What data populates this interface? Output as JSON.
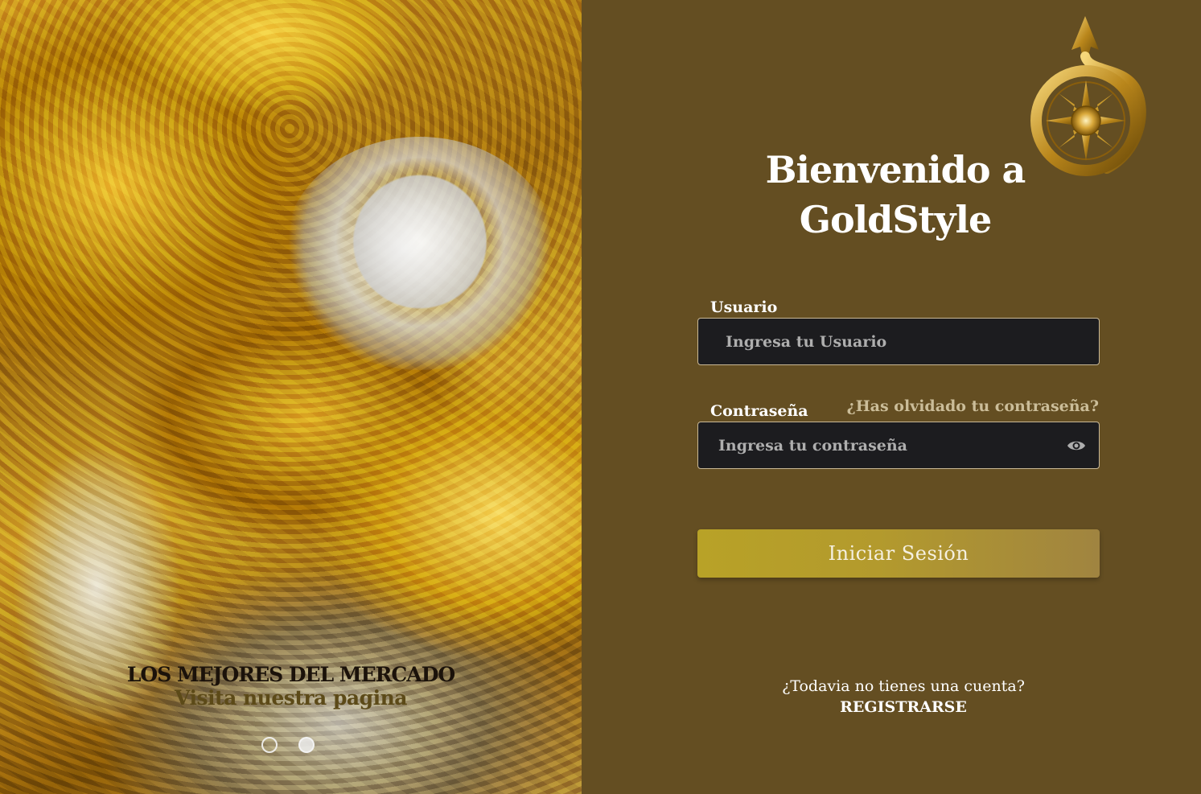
{
  "hero": {
    "title": "LOS MEJORES DEL MERCADO",
    "subtitle": "Visita nuestra pagina",
    "slides": 2,
    "active_slide": 2
  },
  "login": {
    "welcome_line1": "Bienvenido a",
    "welcome_line2": "GoldStyle",
    "user_label": "Usuario",
    "user_placeholder": "Ingresa tu Usuario",
    "password_label": "Contraseña",
    "password_placeholder": "Ingresa tu contraseña",
    "forgot_password": "¿Has olvidado tu contraseña?",
    "submit_label": "Iniciar Sesión",
    "no_account_text": "¿Todavia no tienes una cuenta?",
    "register_label": "REGISTRARSE"
  },
  "colors": {
    "panel_bg": "#644e22",
    "input_bg": "#1c1c1f",
    "button_gold": "#b8a227",
    "forgot_link": "#cbbd99"
  },
  "icons": {
    "logo": "gold-compass-logo-icon",
    "password_toggle": "eye-icon"
  }
}
